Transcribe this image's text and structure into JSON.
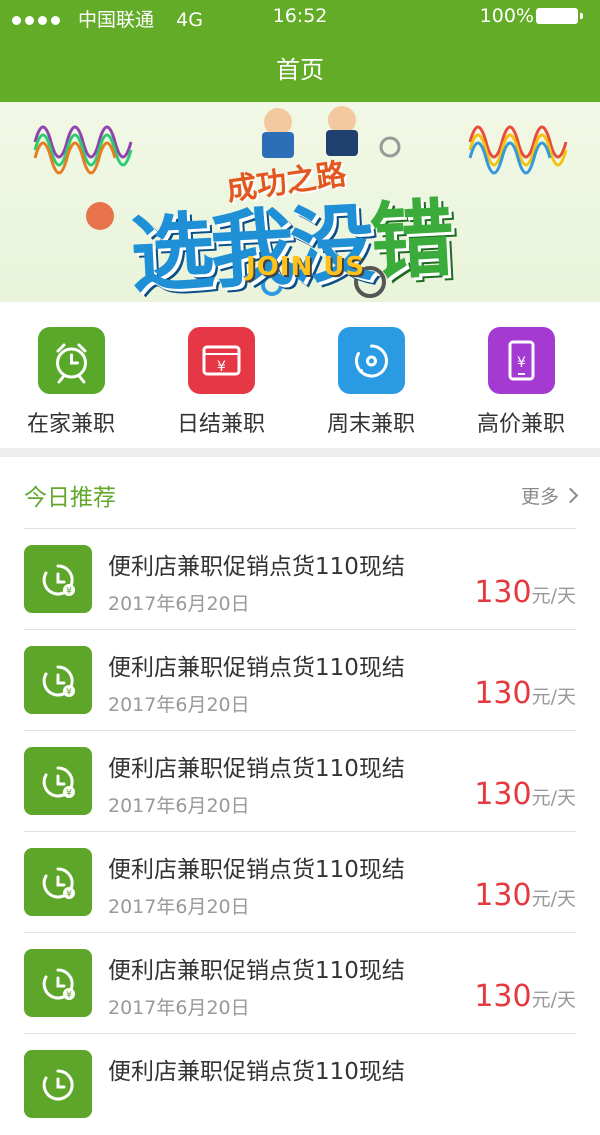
{
  "status_bar": {
    "carrier": "中国联通",
    "network": "4G",
    "time": "16:52",
    "battery": "100%"
  },
  "header": {
    "title": "首页"
  },
  "banner": {
    "slogan_small": "成功之路",
    "slogan_big_a": "选我没",
    "slogan_big_b": "错",
    "join": "JOIN US"
  },
  "categories": [
    {
      "label": "在家兼职",
      "icon": "alarm-clock-icon",
      "color": "#5aa82a"
    },
    {
      "label": "日结兼职",
      "icon": "yen-wallet-icon",
      "color": "#e53745"
    },
    {
      "label": "周末兼职",
      "icon": "clock-dial-icon",
      "color": "#2a9be3"
    },
    {
      "label": "高价兼职",
      "icon": "yen-phone-icon",
      "color": "#a43ad2"
    }
  ],
  "recommend": {
    "title": "今日推荐",
    "more": "更多",
    "items": [
      {
        "name": "便利店兼职促销点货110现结",
        "date": "2017年6月20日",
        "price": "130",
        "unit": "元/天"
      },
      {
        "name": "便利店兼职促销点货110现结",
        "date": "2017年6月20日",
        "price": "130",
        "unit": "元/天"
      },
      {
        "name": "便利店兼职促销点货110现结",
        "date": "2017年6月20日",
        "price": "130",
        "unit": "元/天"
      },
      {
        "name": "便利店兼职促销点货110现结",
        "date": "2017年6月20日",
        "price": "130",
        "unit": "元/天"
      },
      {
        "name": "便利店兼职促销点货110现结",
        "date": "2017年6月20日",
        "price": "130",
        "unit": "元/天"
      },
      {
        "name": "便利店兼职促销点货110现结",
        "date": "",
        "price": "",
        "unit": ""
      }
    ]
  },
  "theme": {
    "primary": "#63ac28",
    "price": "#e43a3f"
  }
}
